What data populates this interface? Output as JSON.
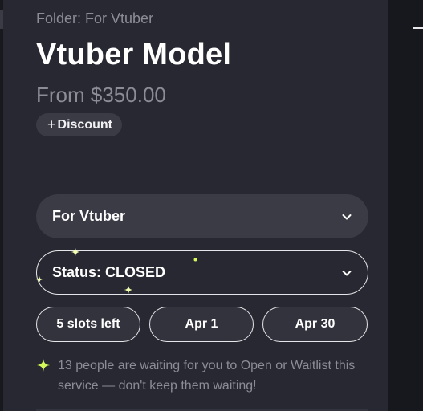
{
  "header": {
    "folder_label": "Folder: For Vtuber",
    "title": "Vtuber Model",
    "price": "From $350.00"
  },
  "discount": {
    "plus": "+",
    "label": "Discount"
  },
  "folder_select": {
    "value": "For Vtuber"
  },
  "status_select": {
    "value": "Status: CLOSED"
  },
  "pills": {
    "slots": "5 slots left",
    "start_date": "Apr 1",
    "end_date": "Apr 30"
  },
  "notice": {
    "text": "13 people are waiting for you to Open or Waitlist this service — don't keep them waiting!"
  },
  "colors": {
    "panel": "#272831",
    "accent_spark": "#d4f75a",
    "muted_text": "#8b8c96"
  },
  "icons": {
    "chevron": "chevron-down-icon",
    "sparkle": "sparkle-icon"
  }
}
